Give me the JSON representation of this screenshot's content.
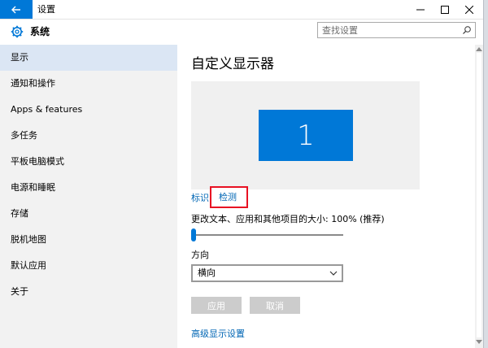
{
  "titlebar": {
    "title": "设置"
  },
  "header": {
    "title": "系统",
    "icon": "gear-icon"
  },
  "search": {
    "placeholder": "查找设置"
  },
  "sidebar": {
    "items": [
      {
        "label": "显示",
        "active": true
      },
      {
        "label": "通知和操作"
      },
      {
        "label": "Apps & features"
      },
      {
        "label": "多任务"
      },
      {
        "label": "平板电脑模式"
      },
      {
        "label": "电源和睡眠"
      },
      {
        "label": "存储"
      },
      {
        "label": "脱机地图"
      },
      {
        "label": "默认应用"
      },
      {
        "label": "关于"
      }
    ]
  },
  "main": {
    "title": "自定义显示器",
    "monitor_number": "1",
    "identify_label": "标识",
    "detect_label": "检测",
    "scale_label": "更改文本、应用和其他项目的大小: 100% (推荐)",
    "scale_value": 0,
    "orientation_label": "方向",
    "orientation_value": "横向",
    "apply_label": "应用",
    "cancel_label": "取消",
    "advanced_link": "高级显示设置"
  },
  "colors": {
    "accent": "#0078d7",
    "highlight": "#e81123",
    "sidebar_bg": "#f2f2f2",
    "active_item": "#dbe6f4"
  }
}
